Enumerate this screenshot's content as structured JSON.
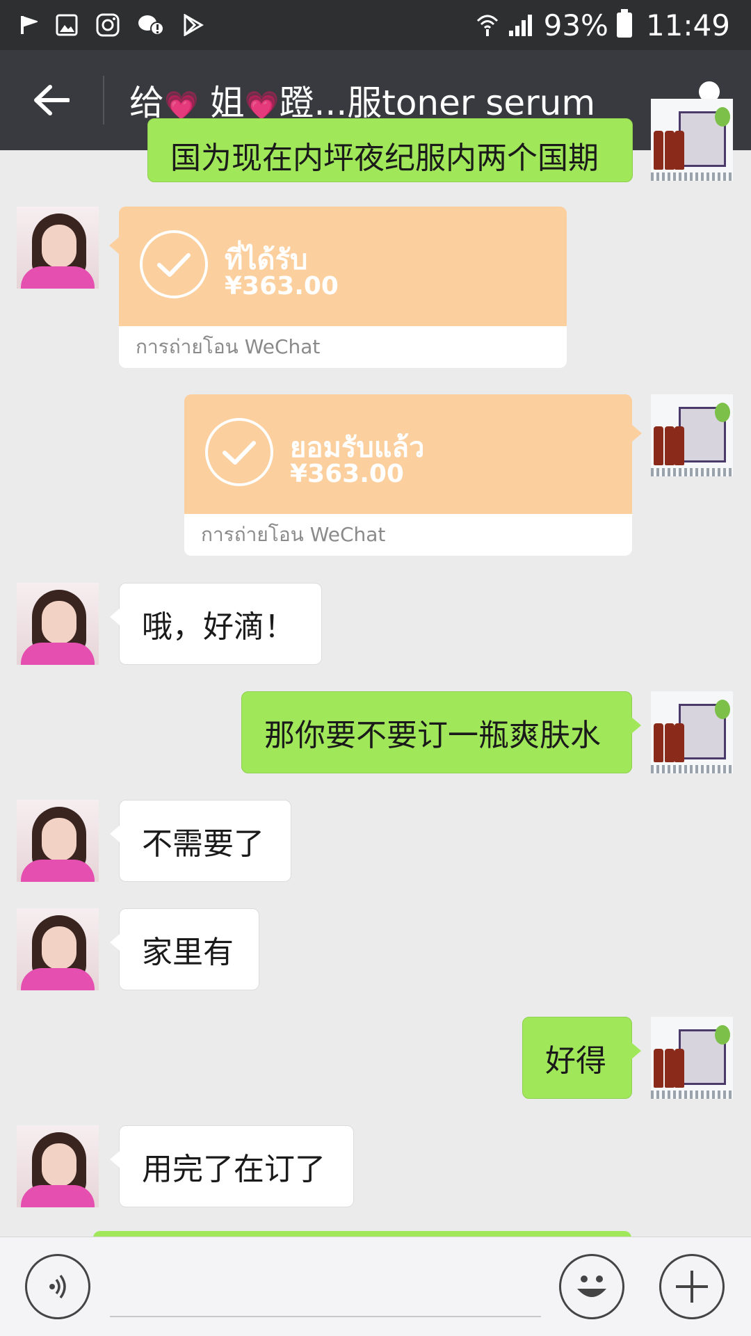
{
  "status": {
    "battery": "93%",
    "time": "11:49"
  },
  "header": {
    "title_prefix": "给",
    "title_mid": "姐",
    "title_suffix": "蹬...服toner serum",
    "heart": "💗"
  },
  "chat": {
    "top_partial": "国为现在内坪夜纪服内两个国期",
    "transfer_received": {
      "status": "ที่ได้รับ",
      "amount": "¥363.00",
      "label": "การถ่ายโอน WeChat"
    },
    "transfer_accepted": {
      "status": "ยอมรับแล้ว",
      "amount": "¥363.00",
      "label": "การถ่ายโอน WeChat"
    },
    "messages": [
      {
        "side": "left",
        "text": "哦，好滴！"
      },
      {
        "side": "right",
        "text": "那你要不要订一瓶爽肤水"
      },
      {
        "side": "left",
        "text": "不需要了"
      },
      {
        "side": "left",
        "text": "家里有"
      },
      {
        "side": "right",
        "text": "好得"
      },
      {
        "side": "left",
        "text": "用完了在订了"
      }
    ]
  }
}
